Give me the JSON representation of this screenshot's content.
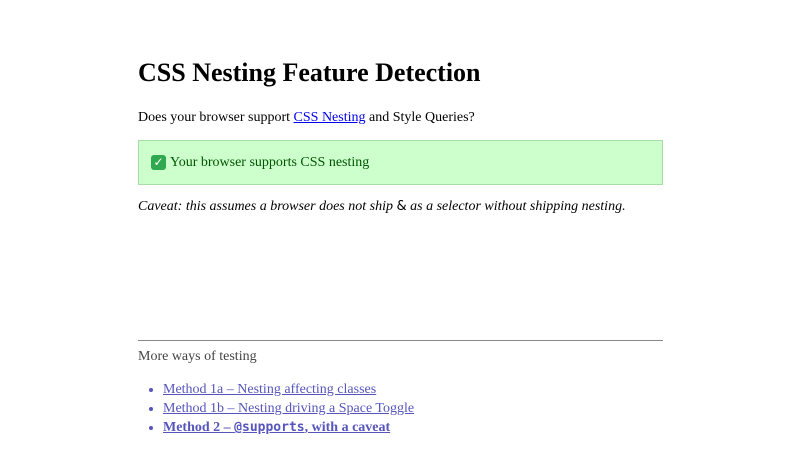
{
  "page": {
    "title": "CSS Nesting Feature Detection",
    "intro": {
      "before": "Does your browser support ",
      "link": "CSS Nesting",
      "after": " and Style Queries?"
    },
    "notice": {
      "icon": "check-mark-icon",
      "message": "Your browser supports CSS nesting",
      "background": "#ccffcc"
    },
    "caveat": {
      "before": "Caveat: this assumes a browser does not ship ",
      "amp": "&",
      "after": " as a selector without shipping nesting."
    }
  },
  "more": {
    "title": "More ways of testing",
    "methods": [
      {
        "label": "Method 1a – Nesting affecting classes"
      },
      {
        "label": "Method 1b – Nesting driving a Space Toggle"
      },
      {
        "prefix": "Method 2 – ",
        "code": "@supports",
        "suffix": ", with a caveat"
      }
    ]
  },
  "colors": {
    "link": "#0000ee",
    "visited_link": "#5555bb",
    "notice_border": "#a6dea6"
  }
}
